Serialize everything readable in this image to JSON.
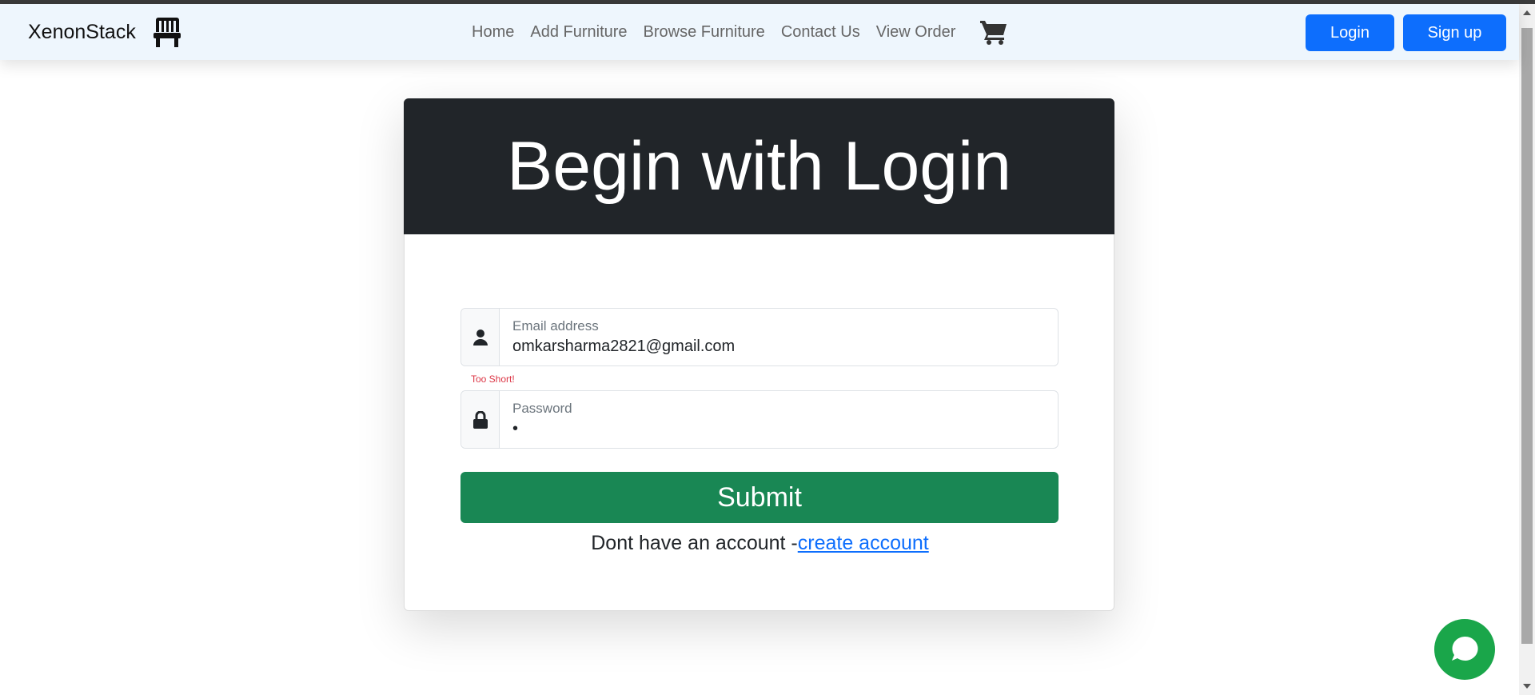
{
  "navbar": {
    "brand": "XenonStack",
    "brand_icon": "chair-icon",
    "links": [
      "Home",
      "Add Furniture",
      "Browse Furniture",
      "Contact Us",
      "View Order"
    ],
    "cart_icon": "cart-icon",
    "login_label": "Login",
    "signup_label": "Sign up"
  },
  "card": {
    "title": "Begin with Login",
    "email": {
      "label": "Email address",
      "value": "omkarsharma2821@gmail.com",
      "icon": "user-icon"
    },
    "error": "Too Short!",
    "password": {
      "label": "Password",
      "value": "•",
      "icon": "lock-icon"
    },
    "submit_label": "Submit",
    "account_prompt": "Dont have an account -",
    "account_link": "create account"
  },
  "chat": {
    "icon": "chat-icon"
  },
  "colors": {
    "nav_bg": "#eef6fd",
    "primary": "#0d6efd",
    "success": "#198754",
    "header_dark": "#212529",
    "error": "#dc3545",
    "chat_green": "#1aa64a"
  }
}
